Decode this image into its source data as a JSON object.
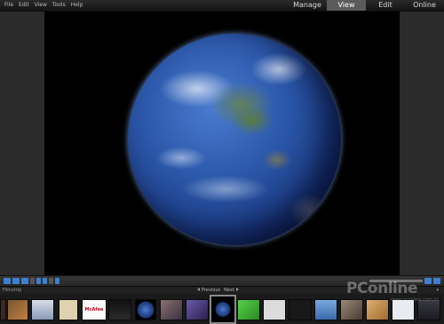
{
  "menu": [
    "File",
    "Edit",
    "View",
    "Tools",
    "Help"
  ],
  "modes": [
    {
      "label": "Manage",
      "active": false
    },
    {
      "label": "View",
      "active": true
    },
    {
      "label": "Edit",
      "active": false
    },
    {
      "label": "Online",
      "active": false
    }
  ],
  "filmstrip": {
    "label": "Filmstrip",
    "previous": "Previous",
    "next": "Next",
    "thumbnails": [
      {
        "name": "thumb-dark",
        "color": "#3a2a22"
      },
      {
        "name": "thumb-portrait",
        "color": "#a07040"
      },
      {
        "name": "thumb-woman",
        "color": "#d8dde8"
      },
      {
        "name": "thumb-beige",
        "color": "#e0d2ae"
      },
      {
        "name": "thumb-mcafee",
        "text": "McAfee",
        "color": "#ffffff"
      },
      {
        "name": "thumb-black-logo",
        "color": "#111111"
      },
      {
        "name": "thumb-earth-small",
        "color": "#2a4c9a"
      },
      {
        "name": "thumb-people",
        "color": "#6a5a60"
      },
      {
        "name": "thumb-purple",
        "color": "#4a3b7a"
      },
      {
        "name": "thumb-selected-earth",
        "color": "#142a66",
        "selected": true
      },
      {
        "name": "thumb-green",
        "color": "#3cb236"
      },
      {
        "name": "thumb-light",
        "color": "#dcdcdc"
      },
      {
        "name": "thumb-pirate",
        "color": "#181818"
      },
      {
        "name": "thumb-sky",
        "color": "#5a8acb"
      },
      {
        "name": "thumb-group",
        "color": "#7a6a5a"
      },
      {
        "name": "thumb-orange",
        "color": "#d0a060"
      },
      {
        "name": "thumb-web",
        "color": "#e8ecf2"
      },
      {
        "name": "thumb-dark-end",
        "color": "#2a2a30"
      }
    ]
  },
  "watermark": {
    "brand": "PConline",
    "url": "www.pconline.com.cn"
  }
}
